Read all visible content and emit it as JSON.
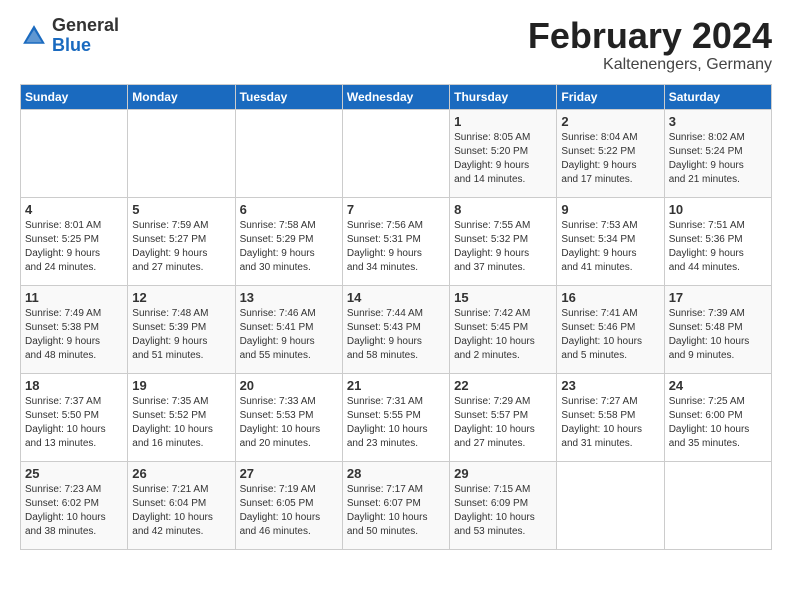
{
  "logo": {
    "general": "General",
    "blue": "Blue"
  },
  "title": "February 2024",
  "subtitle": "Kaltenengers, Germany",
  "headers": [
    "Sunday",
    "Monday",
    "Tuesday",
    "Wednesday",
    "Thursday",
    "Friday",
    "Saturday"
  ],
  "weeks": [
    [
      {
        "day": "",
        "info": ""
      },
      {
        "day": "",
        "info": ""
      },
      {
        "day": "",
        "info": ""
      },
      {
        "day": "",
        "info": ""
      },
      {
        "day": "1",
        "info": "Sunrise: 8:05 AM\nSunset: 5:20 PM\nDaylight: 9 hours\nand 14 minutes."
      },
      {
        "day": "2",
        "info": "Sunrise: 8:04 AM\nSunset: 5:22 PM\nDaylight: 9 hours\nand 17 minutes."
      },
      {
        "day": "3",
        "info": "Sunrise: 8:02 AM\nSunset: 5:24 PM\nDaylight: 9 hours\nand 21 minutes."
      }
    ],
    [
      {
        "day": "4",
        "info": "Sunrise: 8:01 AM\nSunset: 5:25 PM\nDaylight: 9 hours\nand 24 minutes."
      },
      {
        "day": "5",
        "info": "Sunrise: 7:59 AM\nSunset: 5:27 PM\nDaylight: 9 hours\nand 27 minutes."
      },
      {
        "day": "6",
        "info": "Sunrise: 7:58 AM\nSunset: 5:29 PM\nDaylight: 9 hours\nand 30 minutes."
      },
      {
        "day": "7",
        "info": "Sunrise: 7:56 AM\nSunset: 5:31 PM\nDaylight: 9 hours\nand 34 minutes."
      },
      {
        "day": "8",
        "info": "Sunrise: 7:55 AM\nSunset: 5:32 PM\nDaylight: 9 hours\nand 37 minutes."
      },
      {
        "day": "9",
        "info": "Sunrise: 7:53 AM\nSunset: 5:34 PM\nDaylight: 9 hours\nand 41 minutes."
      },
      {
        "day": "10",
        "info": "Sunrise: 7:51 AM\nSunset: 5:36 PM\nDaylight: 9 hours\nand 44 minutes."
      }
    ],
    [
      {
        "day": "11",
        "info": "Sunrise: 7:49 AM\nSunset: 5:38 PM\nDaylight: 9 hours\nand 48 minutes."
      },
      {
        "day": "12",
        "info": "Sunrise: 7:48 AM\nSunset: 5:39 PM\nDaylight: 9 hours\nand 51 minutes."
      },
      {
        "day": "13",
        "info": "Sunrise: 7:46 AM\nSunset: 5:41 PM\nDaylight: 9 hours\nand 55 minutes."
      },
      {
        "day": "14",
        "info": "Sunrise: 7:44 AM\nSunset: 5:43 PM\nDaylight: 9 hours\nand 58 minutes."
      },
      {
        "day": "15",
        "info": "Sunrise: 7:42 AM\nSunset: 5:45 PM\nDaylight: 10 hours\nand 2 minutes."
      },
      {
        "day": "16",
        "info": "Sunrise: 7:41 AM\nSunset: 5:46 PM\nDaylight: 10 hours\nand 5 minutes."
      },
      {
        "day": "17",
        "info": "Sunrise: 7:39 AM\nSunset: 5:48 PM\nDaylight: 10 hours\nand 9 minutes."
      }
    ],
    [
      {
        "day": "18",
        "info": "Sunrise: 7:37 AM\nSunset: 5:50 PM\nDaylight: 10 hours\nand 13 minutes."
      },
      {
        "day": "19",
        "info": "Sunrise: 7:35 AM\nSunset: 5:52 PM\nDaylight: 10 hours\nand 16 minutes."
      },
      {
        "day": "20",
        "info": "Sunrise: 7:33 AM\nSunset: 5:53 PM\nDaylight: 10 hours\nand 20 minutes."
      },
      {
        "day": "21",
        "info": "Sunrise: 7:31 AM\nSunset: 5:55 PM\nDaylight: 10 hours\nand 23 minutes."
      },
      {
        "day": "22",
        "info": "Sunrise: 7:29 AM\nSunset: 5:57 PM\nDaylight: 10 hours\nand 27 minutes."
      },
      {
        "day": "23",
        "info": "Sunrise: 7:27 AM\nSunset: 5:58 PM\nDaylight: 10 hours\nand 31 minutes."
      },
      {
        "day": "24",
        "info": "Sunrise: 7:25 AM\nSunset: 6:00 PM\nDaylight: 10 hours\nand 35 minutes."
      }
    ],
    [
      {
        "day": "25",
        "info": "Sunrise: 7:23 AM\nSunset: 6:02 PM\nDaylight: 10 hours\nand 38 minutes."
      },
      {
        "day": "26",
        "info": "Sunrise: 7:21 AM\nSunset: 6:04 PM\nDaylight: 10 hours\nand 42 minutes."
      },
      {
        "day": "27",
        "info": "Sunrise: 7:19 AM\nSunset: 6:05 PM\nDaylight: 10 hours\nand 46 minutes."
      },
      {
        "day": "28",
        "info": "Sunrise: 7:17 AM\nSunset: 6:07 PM\nDaylight: 10 hours\nand 50 minutes."
      },
      {
        "day": "29",
        "info": "Sunrise: 7:15 AM\nSunset: 6:09 PM\nDaylight: 10 hours\nand 53 minutes."
      },
      {
        "day": "",
        "info": ""
      },
      {
        "day": "",
        "info": ""
      }
    ]
  ]
}
